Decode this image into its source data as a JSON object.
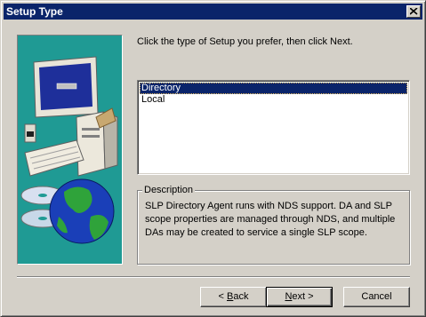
{
  "window": {
    "title": "Setup Type"
  },
  "instruction": "Click the type of Setup you prefer, then click Next.",
  "setup_types": {
    "items": [
      {
        "label": "Directory",
        "selected": true
      },
      {
        "label": "Local",
        "selected": false
      }
    ]
  },
  "description": {
    "label": "Description",
    "text": "SLP Directory Agent runs with NDS support.  DA and SLP scope properties are managed through NDS, and multiple DAs may be created to service a single SLP scope."
  },
  "buttons": {
    "back": {
      "prefix": "< ",
      "accel": "B",
      "rest": "ack"
    },
    "next": {
      "accel": "N",
      "rest": "ext >"
    },
    "cancel": "Cancel"
  },
  "colors": {
    "title_bar": "#0a246a",
    "art_background": "#1f9a94",
    "selection": "#0a246a",
    "face": "#d4d0c8"
  },
  "icons": [
    "close-icon",
    "computer-icon",
    "globe-cd-icon"
  ]
}
